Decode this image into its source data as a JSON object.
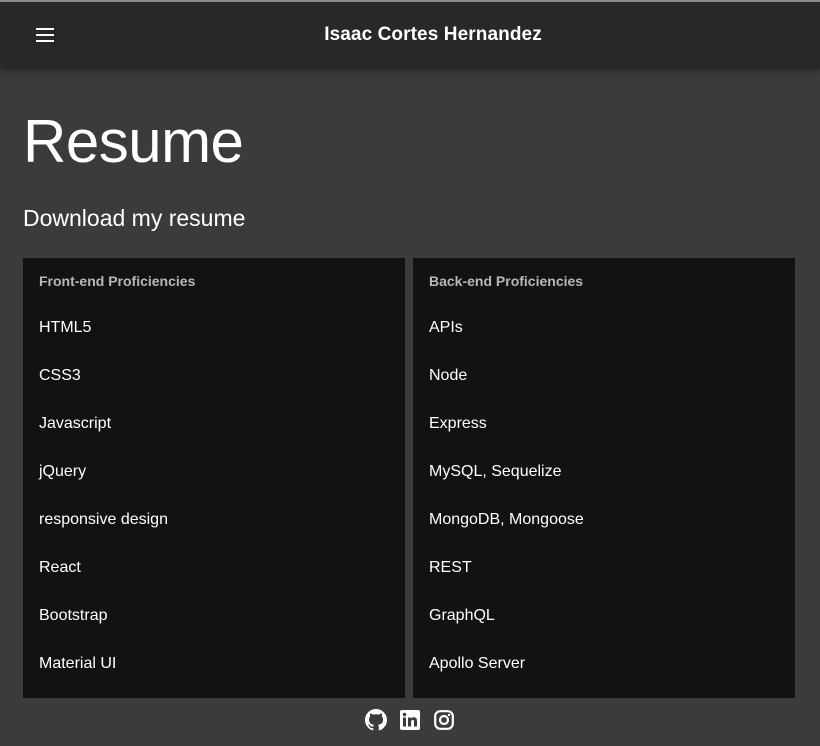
{
  "header": {
    "title": "Isaac Cortes Hernandez",
    "menu_icon": "hamburger-menu-icon"
  },
  "main": {
    "title": "Resume",
    "download_label": "Download my resume"
  },
  "frontend": {
    "title": "Front-end Proficiencies",
    "items": [
      "HTML5",
      "CSS3",
      "Javascript",
      "jQuery",
      "responsive design",
      "React",
      "Bootstrap",
      "Material UI"
    ]
  },
  "backend": {
    "title": "Back-end Proficiencies",
    "items": [
      "APIs",
      "Node",
      "Express",
      "MySQL, Sequelize",
      "MongoDB, Mongoose",
      "REST",
      "GraphQL",
      "Apollo Server"
    ]
  },
  "footer": {
    "icons": [
      "github-icon",
      "linkedin-icon",
      "instagram-icon"
    ]
  },
  "colors": {
    "background": "#3b3b3b",
    "appbar": "#282828",
    "panel": "#121212",
    "text": "#ffffff",
    "subheader": "#b8b8b8"
  }
}
